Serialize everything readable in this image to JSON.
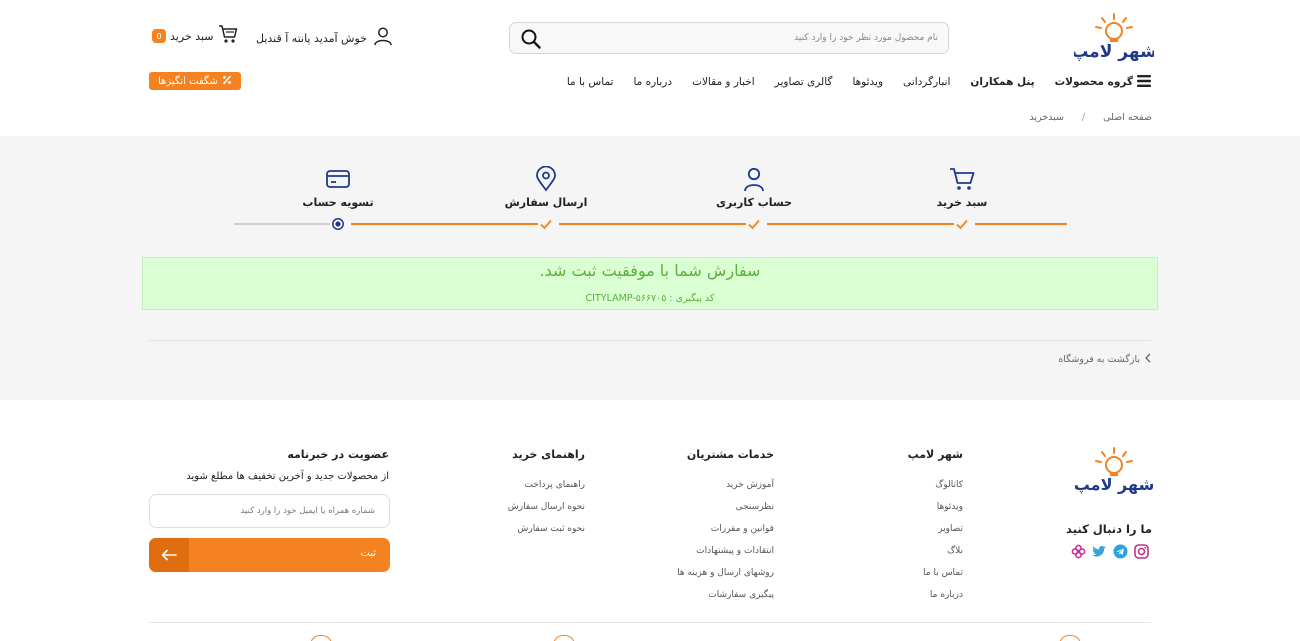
{
  "colors": {
    "accent": "#f58220",
    "success_bg": "#d9ffd3",
    "success_text": "#5bb03b"
  },
  "header": {
    "logo_text": "شهر لامپ",
    "search_placeholder": "نام محصول مورد نظر خود را وارد کنید",
    "user_label": "خوش آمدید پانته آ قندیل",
    "cart_label": "سبد خرید",
    "cart_count": "0",
    "nav": [
      "گروه محصولات",
      "پنل همکاران",
      "انبارگردانی",
      "ویدئوها",
      "گالری تصاویر",
      "اخبار و مقالات",
      "درباره ما",
      "تماس با ما"
    ],
    "promo_label": "شگفت انگیزها"
  },
  "breadcrumb": {
    "home": "صفحه اصلی",
    "separator": "/",
    "current": "سبدخرید"
  },
  "steps": [
    "سبد خرید",
    "حساب کاربری",
    "ارسال سفارش",
    "تسویه حساب"
  ],
  "success": {
    "title": "سفارش شما با موفقیت ثبت شد.",
    "code_label": "کد پیگیری : CITYLAMP-۵۶۶۷۰۵"
  },
  "back_link": "بازگشت به فروشگاه",
  "footer": {
    "follow_title": "ما را دنبال کنید",
    "socials": [
      "instagram-icon",
      "telegram-icon",
      "twitter-icon",
      "flower-icon"
    ],
    "columns": [
      {
        "title": "شهر لامپ",
        "links": [
          "کاتالوگ",
          "ویدئوها",
          "تصاویر",
          "بلاگ",
          "تماس با ما",
          "درباره ما"
        ]
      },
      {
        "title": "خدمات مشتریان",
        "links": [
          "آموزش خرید",
          "نظرسنجی",
          "قوانین و مقررات",
          "انتقادات و پیشنهادات",
          "روشهای ارسال و هزینه ها",
          "پیگیری سفارشات"
        ]
      },
      {
        "title": "راهنمای خرید",
        "links": [
          "راهنمای پرداخت",
          "نحوه ارسال سفارش",
          "نحوه ثبت سفارش"
        ]
      }
    ],
    "newsletter": {
      "title": "عضویت در خبرنامه",
      "subtitle": "از محصولات جدید و آخرین تخفیف ها مطلع شوید",
      "placeholder": "شماره همراه یا ایمیل خود را وارد کنید",
      "button_label": "ثبت"
    }
  }
}
